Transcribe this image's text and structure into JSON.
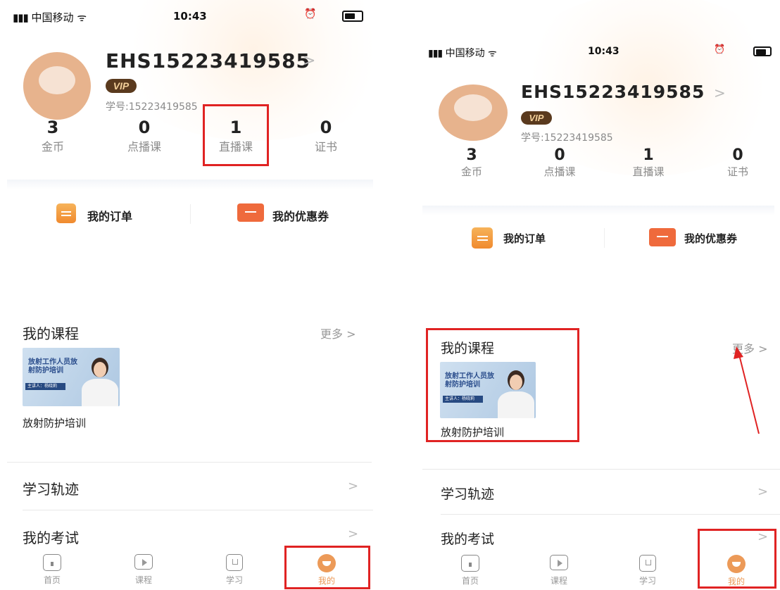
{
  "status_bar": {
    "signal": "▮▮▮",
    "carrier": "中国移动",
    "wifi": "ᯤ",
    "time": "10:43"
  },
  "profile": {
    "username": "EHS15223419585",
    "chevron": ">",
    "vip_label": "VIP",
    "student_id_label": "学号:15223419585"
  },
  "stats": [
    {
      "value": "3",
      "label": "金币"
    },
    {
      "value": "0",
      "label": "点播课"
    },
    {
      "value": "1",
      "label": "直播课"
    },
    {
      "value": "0",
      "label": "证书"
    }
  ],
  "quick_links": {
    "orders": "我的订单",
    "coupons": "我的优惠券"
  },
  "courses": {
    "title": "我的课程",
    "more": "更多 >",
    "thumb_title": "放射工作人员放射防护培训",
    "thumb_bar": "主讲人：杨晓莉",
    "course_name": "放射防护培训"
  },
  "list_rows": [
    {
      "label": "学习轨迹",
      "chevron": ">"
    },
    {
      "label": "我的考试",
      "chevron": ">"
    }
  ],
  "tabs": [
    {
      "label": "首页",
      "icon": "home-icon"
    },
    {
      "label": "课程",
      "icon": "play-icon"
    },
    {
      "label": "学习",
      "icon": "bookmark-icon"
    },
    {
      "label": "我的",
      "icon": "profile-icon"
    }
  ],
  "colors": {
    "highlight": "#e02323",
    "active_tab": "#ec9a58",
    "vip_bg": "#5a3a1e"
  }
}
